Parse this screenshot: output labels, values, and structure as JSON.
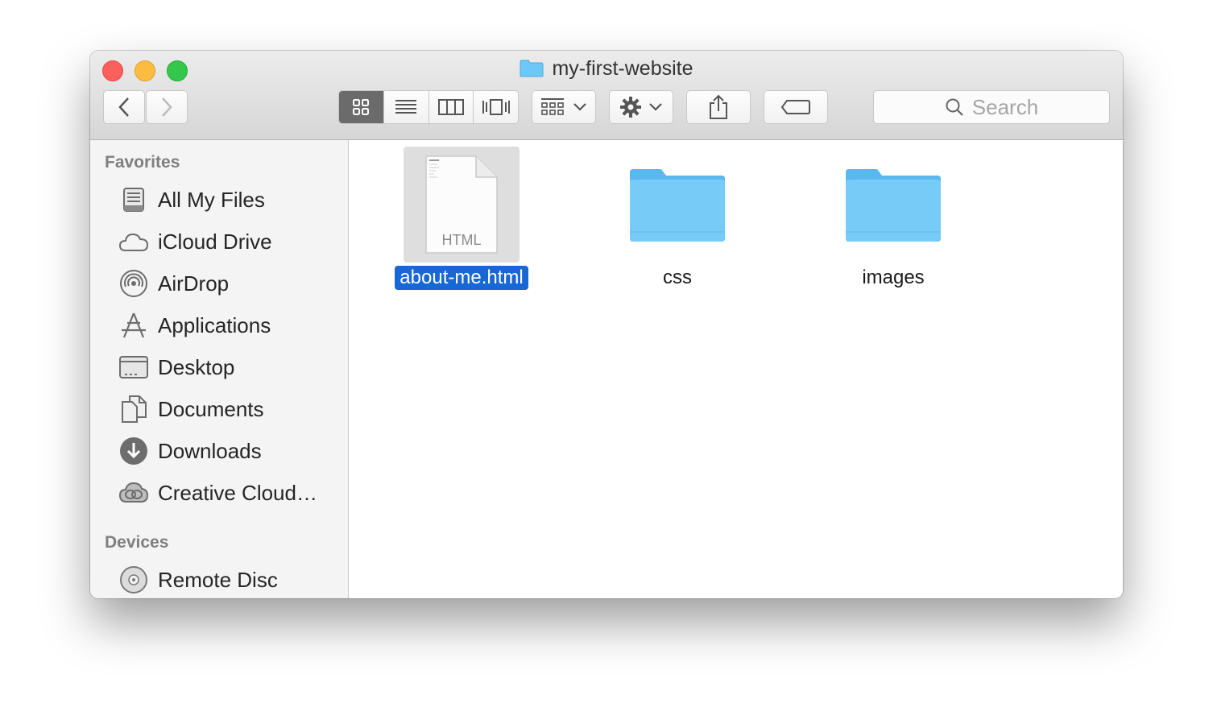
{
  "window": {
    "title": "my-first-website"
  },
  "toolbar": {
    "search_placeholder": "Search"
  },
  "sidebar": {
    "favorites_heading": "Favorites",
    "favorites": [
      {
        "label": "All My Files",
        "icon": "all-files-icon"
      },
      {
        "label": "iCloud Drive",
        "icon": "cloud-icon"
      },
      {
        "label": "AirDrop",
        "icon": "airdrop-icon"
      },
      {
        "label": "Applications",
        "icon": "applications-icon"
      },
      {
        "label": "Desktop",
        "icon": "desktop-icon"
      },
      {
        "label": "Documents",
        "icon": "documents-icon"
      },
      {
        "label": "Downloads",
        "icon": "downloads-icon"
      },
      {
        "label": "Creative Cloud…",
        "icon": "creative-cloud-icon"
      }
    ],
    "devices_heading": "Devices",
    "devices": [
      {
        "label": "Remote Disc",
        "icon": "disc-icon"
      }
    ]
  },
  "files": [
    {
      "name": "about-me.html",
      "kind": "HTML",
      "selected": true
    },
    {
      "name": "css",
      "kind": "folder",
      "selected": false
    },
    {
      "name": "images",
      "kind": "folder",
      "selected": false
    }
  ],
  "colors": {
    "folder": "#66c4f5",
    "selection": "#1767d4"
  }
}
